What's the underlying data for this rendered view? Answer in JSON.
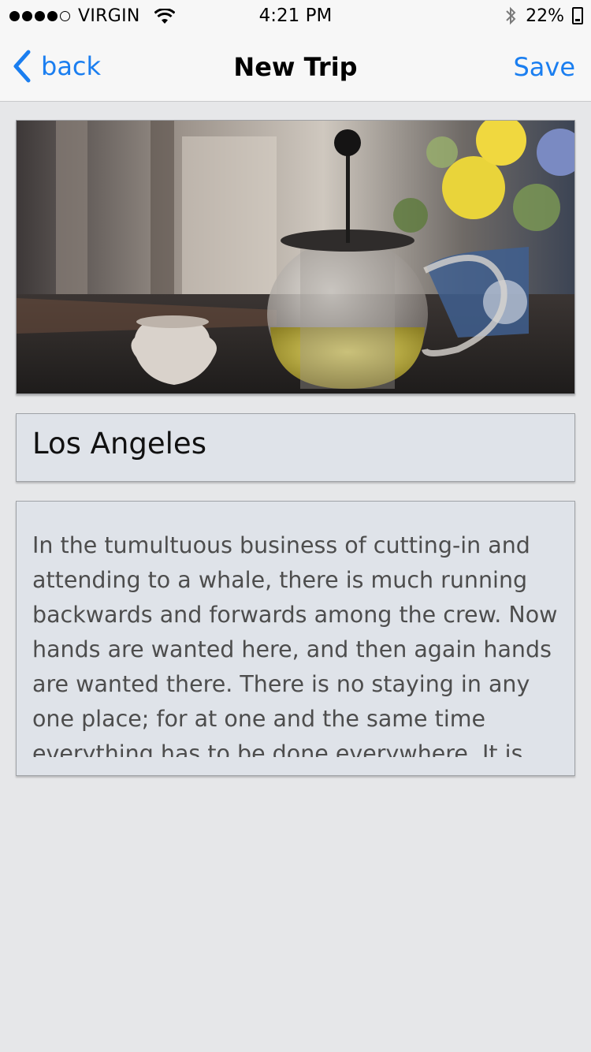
{
  "status_bar": {
    "carrier": "VIRGIN",
    "time": "4:21 PM",
    "battery": "22%",
    "signal_bars_filled": 4,
    "signal_bars_total": 5,
    "battery_level": 0.22
  },
  "nav": {
    "back_label": "back",
    "title": "New Trip",
    "save_label": "Save",
    "accent_color": "#1a7ef0"
  },
  "trip": {
    "photo_alt": "",
    "name": "Los Angeles",
    "description": "In the tumultuous business of cutting-in and attending to a whale, there is much running backwards and forwards among the crew. Now hands are wanted here, and then again hands are wanted there. There is no staying in any one place; for at one and the same time everything has to be done everywhere. It is"
  }
}
